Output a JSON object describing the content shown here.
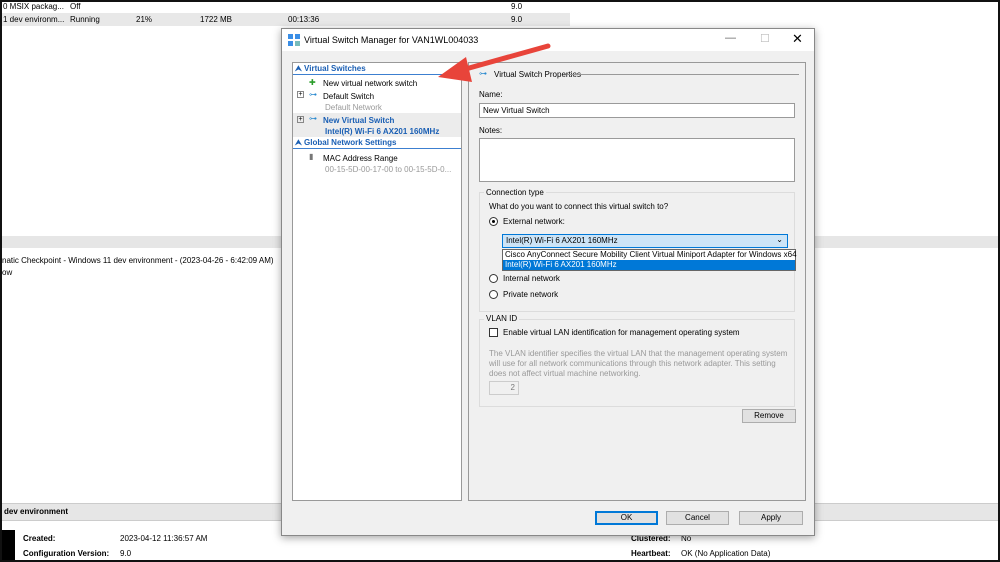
{
  "background": {
    "vm_rows": [
      {
        "name": "0 MSIX packag...",
        "state": "Off",
        "cpu": "",
        "memory": "",
        "uptime": "",
        "version": "9.0"
      },
      {
        "name": "1 dev environm...",
        "state": "Running",
        "cpu": "21%",
        "memory": "1722 MB",
        "uptime": "00:13:36",
        "version": "9.0"
      }
    ],
    "checkpoint": "natic Checkpoint - Windows 11 dev environment - (2023-04-26 - 6:42:09 AM)",
    "checkpoint_sub": "ow",
    "details_title": "dev environment",
    "created_label": "Created:",
    "created_value": "2023-04-12 11:36:57 AM",
    "config_label": "Configuration Version:",
    "config_value": "9.0",
    "clustered_label": "Clustered:",
    "clustered_value": "No",
    "heartbeat_label": "Heartbeat:",
    "heartbeat_value": "OK (No Application Data)"
  },
  "dialog": {
    "title": "Virtual Switch Manager for VAN1WL004033",
    "tree": {
      "virtual_switches": "Virtual Switches",
      "new_switch": "New virtual network switch",
      "default_switch": "Default Switch",
      "default_switch_sub": "Default Network",
      "selected_switch": "New Virtual Switch",
      "selected_switch_sub": "Intel(R) Wi-Fi 6 AX201 160MHz",
      "global": "Global Network Settings",
      "mac": "MAC Address Range",
      "mac_sub": "00-15-5D-00-17-00 to 00-15-5D-0..."
    },
    "props": {
      "header": "Virtual Switch Properties",
      "name_label": "Name:",
      "name_value": "New Virtual Switch",
      "notes_label": "Notes:",
      "notes_value": "",
      "conn_legend": "Connection type",
      "conn_question": "What do you want to connect this virtual switch to?",
      "external": "External network:",
      "internal": "Internal network",
      "private": "Private network",
      "selected_connection": "external",
      "adapter_selected": "Intel(R) Wi-Fi 6 AX201 160MHz",
      "adapter_options": [
        "Cisco AnyConnect Secure Mobility Client Virtual Miniport Adapter for Windows x64",
        "Intel(R) Wi-Fi 6 AX201 160MHz"
      ],
      "vlan_legend": "VLAN ID",
      "vlan_enable": "Enable virtual LAN identification for management operating system",
      "vlan_enabled": false,
      "vlan_desc": "The VLAN identifier specifies the virtual LAN that the management operating system will use for all network communications through this network adapter. This setting does not affect virtual machine networking.",
      "vlan_value": "2",
      "remove": "Remove"
    },
    "buttons": {
      "ok": "OK",
      "cancel": "Cancel",
      "apply": "Apply"
    }
  },
  "colors": {
    "accent": "#0078d7",
    "arrow": "#e8443a",
    "link": "#1a5fb4"
  }
}
